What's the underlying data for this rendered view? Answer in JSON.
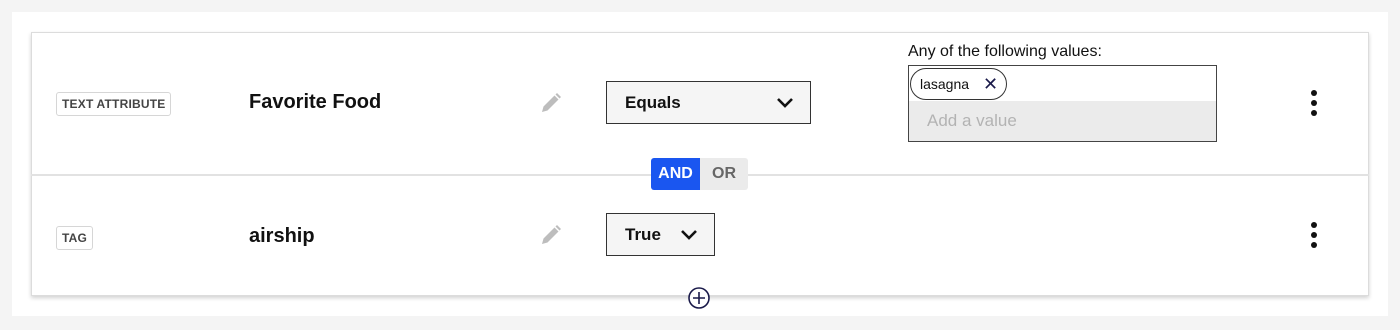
{
  "rules": [
    {
      "type_badge": "TEXT ATTRIBUTE",
      "name": "Favorite Food",
      "operator": "Equals",
      "values_label": "Any of the following values:",
      "values": [
        "lasagna"
      ],
      "add_value_placeholder": "Add a value"
    },
    {
      "type_badge": "TAG",
      "name": "airship",
      "operator": "True"
    }
  ],
  "connector": {
    "and_label": "AND",
    "or_label": "OR",
    "selected": "AND"
  },
  "icons": {
    "edit": "pencil-icon",
    "dropdown": "chevron-down-icon",
    "remove_chip": "close-icon",
    "more": "kebab-menu-icon",
    "add": "plus-circle-icon"
  },
  "colors": {
    "accent": "#1a56f0",
    "chip_x": "#1a1a4a"
  }
}
